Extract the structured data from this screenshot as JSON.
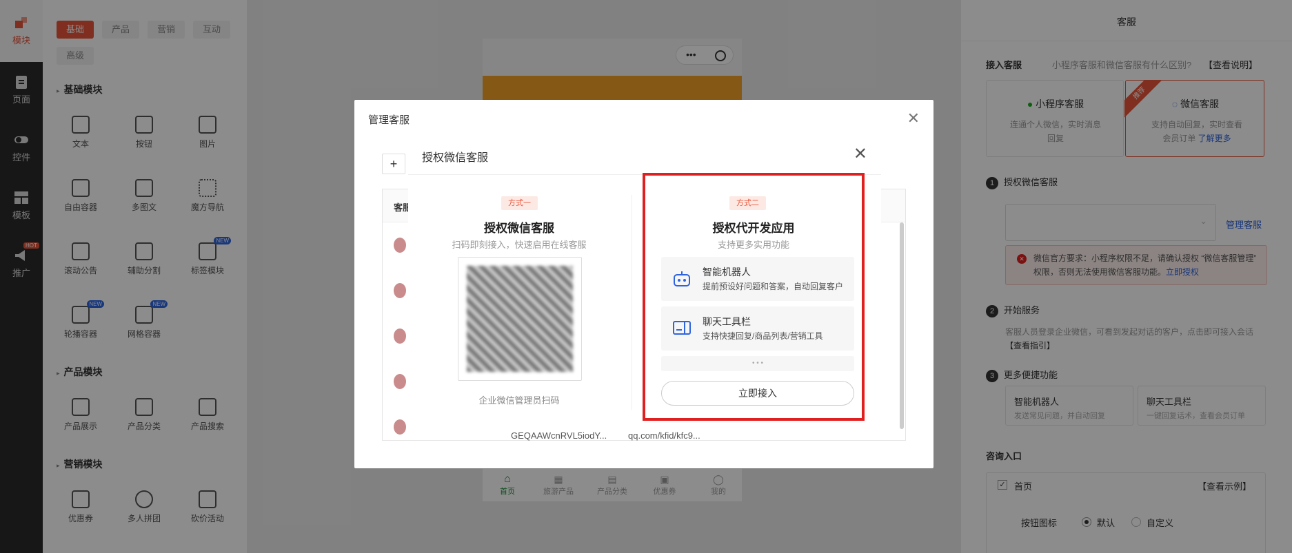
{
  "nav": {
    "items": [
      {
        "label": "模块",
        "icon": "module-icon"
      },
      {
        "label": "页面",
        "icon": "page-icon"
      },
      {
        "label": "控件",
        "icon": "toggle-icon"
      },
      {
        "label": "模板",
        "icon": "template-icon"
      },
      {
        "label": "推广",
        "icon": "megaphone-icon",
        "badge": "HOT"
      }
    ]
  },
  "panel": {
    "tabs": [
      "基础",
      "产品",
      "营销",
      "互动",
      "高级"
    ],
    "sections": [
      {
        "title": "基础模块",
        "items": [
          {
            "label": "文本"
          },
          {
            "label": "按钮"
          },
          {
            "label": "图片"
          },
          {
            "label": "自由容器"
          },
          {
            "label": "多图文"
          },
          {
            "label": "魔方导航"
          },
          {
            "label": "滚动公告"
          },
          {
            "label": "辅助分割"
          },
          {
            "label": "标签模块",
            "badge": "NEW"
          },
          {
            "label": "轮播容器",
            "badge": "NEW"
          },
          {
            "label": "网格容器",
            "badge": "NEW"
          }
        ]
      },
      {
        "title": "产品模块",
        "items": [
          {
            "label": "产品展示"
          },
          {
            "label": "产品分类"
          },
          {
            "label": "产品搜索"
          }
        ]
      },
      {
        "title": "营销模块",
        "items": [
          {
            "label": "优惠券"
          },
          {
            "label": "多人拼团"
          },
          {
            "label": "砍价活动"
          }
        ]
      }
    ]
  },
  "phone": {
    "tabbar": [
      "首页",
      "旅游产品",
      "产品分类",
      "优惠券",
      "我的"
    ]
  },
  "table_bg": {
    "header": "客服",
    "partial_cells": [
      "GEQAAWcnRVL5iodY...",
      "qq.com/kfid/kfc9..."
    ]
  },
  "settings": {
    "title": "客服",
    "access_label": "接入客服",
    "access_question": "小程序客服和微信客服有什么区别?",
    "access_link": "【查看说明】",
    "option1": {
      "title": "小程序客服",
      "desc": "连通个人微信，实时消息回复"
    },
    "option2": {
      "title": "微信客服",
      "ribbon": "推荐",
      "desc": "支持自动回复，实时查看会员订单",
      "link": "了解更多"
    },
    "step1": "授权微信客服",
    "manage_link": "管理客服",
    "error_text": "微信官方要求：小程序权限不足，请确认授权 “微信客服管理” 权限，否则无法使用微信客服功能。",
    "error_link": "立即授权",
    "step2": "开始服务",
    "step2_desc": "客服人员登录企业微信，可看到发起对话的客户，点击即可接入会话",
    "step2_link": "【查看指引】",
    "step3": "更多便捷功能",
    "feat1": {
      "title": "智能机器人",
      "desc": "发送常见问题，并自动回复"
    },
    "feat2": {
      "title": "聊天工具栏",
      "desc": "一键回复话术，查看会员订单"
    },
    "entry_title": "咨询入口",
    "entry_home": "首页",
    "entry_example": "【查看示例】",
    "btn_icon_label": "按钮图标",
    "radio_default": "默认",
    "radio_custom": "自定义"
  },
  "outer_dialog": {
    "title": "管理客服",
    "add_label": "+"
  },
  "dialog": {
    "title": "授权微信客服",
    "left": {
      "tag": "方式一",
      "title": "授权微信客服",
      "subtitle": "扫码即刻接入，快速启用在线客服",
      "caption": "企业微信管理员扫码"
    },
    "right": {
      "tag": "方式二",
      "title": "授权代开发应用",
      "subtitle": "支持更多实用功能",
      "features": [
        {
          "title": "智能机器人",
          "desc": "提前预设好问题和答案，自动回复客户",
          "icon": "robot-icon"
        },
        {
          "title": "聊天工具栏",
          "desc": "支持快捷回复/商品列表/营销工具",
          "icon": "toolbar-icon"
        }
      ],
      "more": "• • •",
      "button": "立即接入"
    }
  },
  "colors": {
    "accent": "#e8553a",
    "link": "#2f64e0",
    "highlight": "#e02020"
  }
}
